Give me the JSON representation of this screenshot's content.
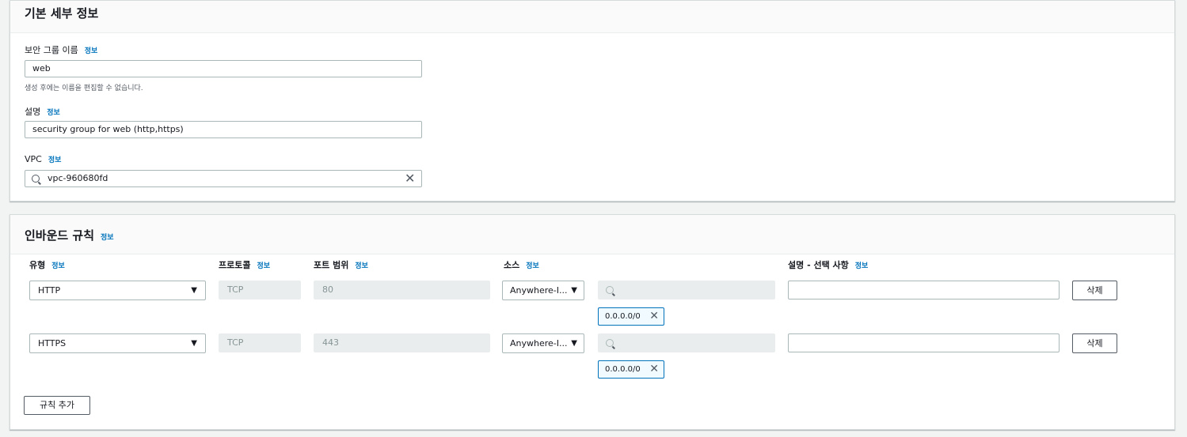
{
  "basic": {
    "title": "기본 세부 정보",
    "sg_name_label": "보안 그룹 이름",
    "info": "정보",
    "sg_name_value": "web",
    "sg_name_hint": "생성 후에는 이름을 편집할 수 없습니다.",
    "desc_label": "설명",
    "desc_value": "security group for web (http,https)",
    "vpc_label": "VPC",
    "vpc_value": "vpc-960680fd"
  },
  "inbound": {
    "title": "인바운드 규칙",
    "info": "정보",
    "columns": {
      "type": "유형",
      "protocol": "프로토콜",
      "port": "포트 범위",
      "source": "소스",
      "description": "설명 - 선택 사항"
    },
    "rules": [
      {
        "type": "HTTP",
        "protocol": "TCP",
        "port": "80",
        "source": "Anywhere-I...",
        "cidr": "0.0.0.0/0",
        "delete": "삭제"
      },
      {
        "type": "HTTPS",
        "protocol": "TCP",
        "port": "443",
        "source": "Anywhere-I...",
        "cidr": "0.0.0.0/0",
        "delete": "삭제"
      }
    ],
    "add_rule": "규칙 추가"
  },
  "icons": {
    "search": "search-icon",
    "close": "close-icon",
    "caret": "caret-down-icon"
  }
}
